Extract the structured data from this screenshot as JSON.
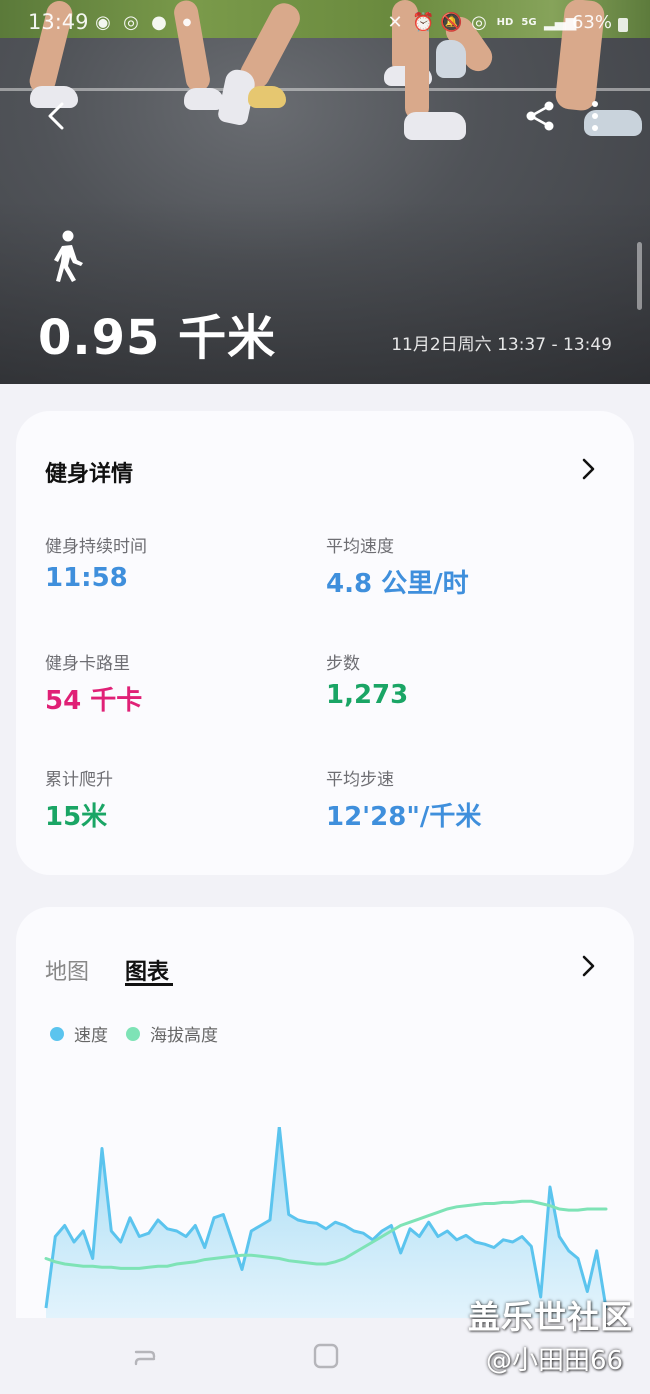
{
  "status_bar": {
    "time": "13:49",
    "network": "HD",
    "signal": "5G",
    "battery": "63%"
  },
  "hero": {
    "activity_icon": "walking-person-icon",
    "distance": "0.95 千米",
    "time_range": "11月2日周六 13:37 - 13:49"
  },
  "details": {
    "title": "健身详情",
    "metrics": [
      {
        "label": "健身持续时间",
        "value": "11:58",
        "color": "#3f8fdc"
      },
      {
        "label": "平均速度",
        "value": "4.8 公里/时",
        "color": "#3f8fdc"
      },
      {
        "label": "健身卡路里",
        "value": "54 千卡",
        "color": "#e02076"
      },
      {
        "label": "步数",
        "value": "1,273",
        "color": "#1aa565"
      },
      {
        "label": "累计爬升",
        "value": "15米",
        "color": "#1aa565"
      },
      {
        "label": "平均步速",
        "value": "12'28\"/千米",
        "color": "#3f8fdc"
      }
    ]
  },
  "chart_card": {
    "tabs": [
      {
        "label": "地图",
        "selected": false
      },
      {
        "label": "图表",
        "selected": true
      }
    ],
    "legend": [
      {
        "label": "速度",
        "color": "#5bc4ee"
      },
      {
        "label": "海拔高度",
        "color": "#7ee3b6"
      }
    ]
  },
  "chart_data": {
    "type": "line",
    "title": "",
    "xlabel": "",
    "ylabel": "",
    "grid": false,
    "x": [
      0,
      1,
      2,
      3,
      4,
      5,
      6,
      7,
      8,
      9,
      10,
      11,
      12,
      13,
      14,
      15,
      16,
      17,
      18,
      19,
      20,
      21,
      22,
      23,
      24,
      25,
      26,
      27,
      28,
      29,
      30,
      31,
      32,
      33,
      34,
      35,
      36,
      37,
      38,
      39,
      40,
      41,
      42,
      43,
      44,
      45,
      46,
      47,
      48,
      49,
      50,
      51,
      52,
      53,
      54,
      55,
      56,
      57,
      58,
      59,
      60
    ],
    "series": [
      {
        "name": "速度",
        "color": "#5bc4ee",
        "fill": true,
        "values": [
          0.1,
          0.75,
          0.85,
          0.7,
          0.8,
          0.55,
          1.55,
          0.8,
          0.7,
          0.92,
          0.75,
          0.78,
          0.9,
          0.82,
          0.8,
          0.75,
          0.85,
          0.65,
          0.92,
          0.95,
          0.7,
          0.45,
          0.8,
          0.85,
          0.9,
          1.75,
          0.95,
          0.9,
          0.88,
          0.87,
          0.82,
          0.88,
          0.85,
          0.8,
          0.78,
          0.72,
          0.8,
          0.85,
          0.6,
          0.82,
          0.75,
          0.88,
          0.75,
          0.8,
          0.72,
          0.76,
          0.7,
          0.68,
          0.65,
          0.72,
          0.7,
          0.75,
          0.66,
          0.2,
          1.2,
          0.75,
          0.62,
          0.55,
          0.25,
          0.62,
          0.1
        ]
      },
      {
        "name": "海拔高度",
        "color": "#7ee3b6",
        "fill": false,
        "values": [
          0.55,
          0.52,
          0.5,
          0.49,
          0.48,
          0.48,
          0.47,
          0.47,
          0.46,
          0.46,
          0.46,
          0.47,
          0.48,
          0.48,
          0.5,
          0.51,
          0.52,
          0.54,
          0.55,
          0.56,
          0.57,
          0.58,
          0.58,
          0.57,
          0.56,
          0.55,
          0.53,
          0.52,
          0.51,
          0.5,
          0.5,
          0.52,
          0.55,
          0.6,
          0.65,
          0.7,
          0.75,
          0.8,
          0.85,
          0.88,
          0.91,
          0.94,
          0.97,
          1.0,
          1.02,
          1.03,
          1.04,
          1.05,
          1.05,
          1.06,
          1.06,
          1.07,
          1.07,
          1.05,
          1.03,
          1.0,
          0.99,
          0.99,
          1.0,
          1.0,
          1.0
        ]
      }
    ]
  },
  "nav": {
    "recent_icon": "recent-apps-icon",
    "home_icon": "home-icon"
  },
  "watermark": {
    "main": "盖乐世社区",
    "sub": "@小田田66"
  }
}
